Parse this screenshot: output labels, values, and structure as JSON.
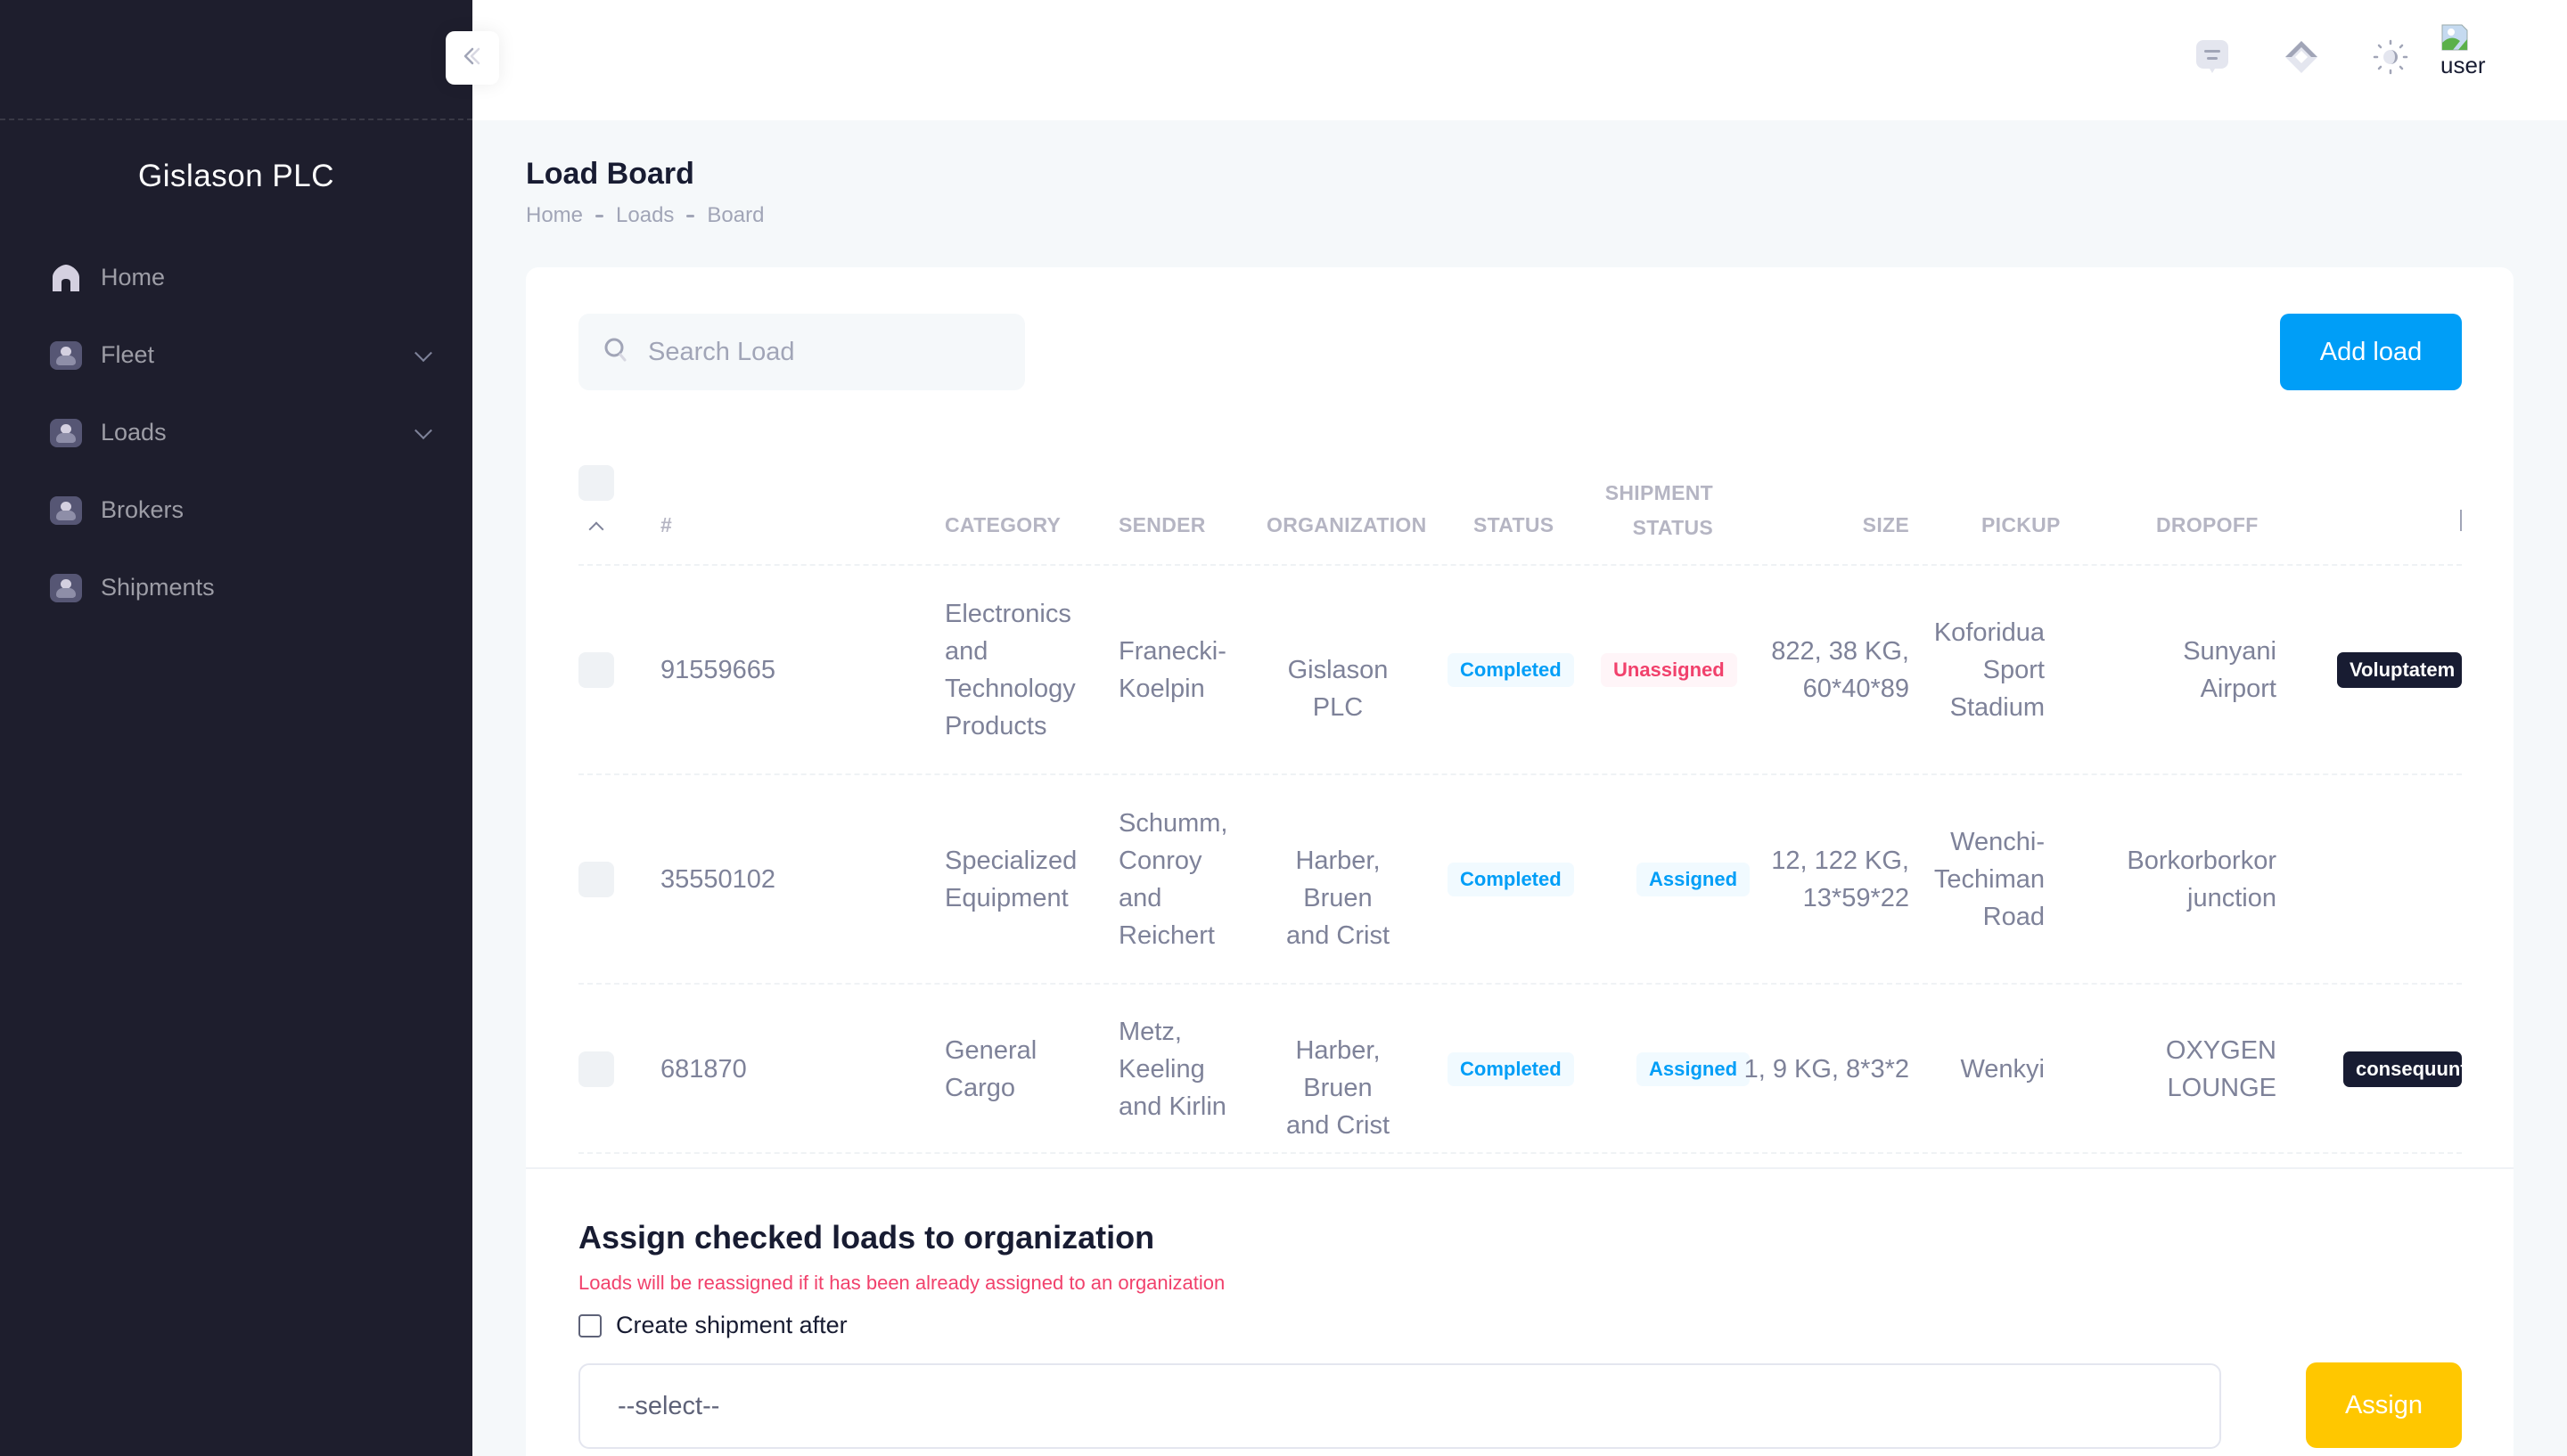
{
  "sidebar": {
    "brand": "Gislason PLC",
    "toggle_icon": "double-chevron-left-icon",
    "items": [
      {
        "label": "Home",
        "icon": "home-icon",
        "expandable": false
      },
      {
        "label": "Fleet",
        "icon": "user-icon",
        "expandable": true
      },
      {
        "label": "Loads",
        "icon": "user-icon",
        "expandable": true
      },
      {
        "label": "Brokers",
        "icon": "user-icon",
        "expandable": false
      },
      {
        "label": "Shipments",
        "icon": "user-icon",
        "expandable": false
      }
    ]
  },
  "header": {
    "icons": [
      "chat-icon",
      "layers-icon",
      "theme-toggle-icon"
    ],
    "user_alt": "user"
  },
  "page": {
    "title": "Load Board",
    "breadcrumb": [
      "Home",
      "Loads",
      "Board"
    ]
  },
  "toolbar": {
    "search_placeholder": "Search Load",
    "add_label": "Add load"
  },
  "table": {
    "columns": {
      "id": "#",
      "category": "CATEGORY",
      "sender": "SENDER",
      "organization": "ORGANIZATION",
      "status": "STATUS",
      "shipment_status_1": "SHIPMENT",
      "shipment_status_2": "STATUS",
      "size": "SIZE",
      "pickup": "PICKUP",
      "dropoff": "DROPOFF"
    },
    "rows": [
      {
        "id": "91559665",
        "category": [
          "Electronics",
          "and",
          "Technology",
          "Products"
        ],
        "sender": [
          "Franecki-",
          "Koelpin"
        ],
        "organization": [
          "Gislason PLC"
        ],
        "status": "Completed",
        "shipment_status": "Unassigned",
        "size": [
          "822, 38 KG,",
          "60*40*89"
        ],
        "pickup": [
          "Koforidua",
          "Sport",
          "Stadium"
        ],
        "dropoff": [
          "Sunyani",
          "Airport"
        ],
        "tag": "Voluptatem"
      },
      {
        "id": "35550102",
        "category": [
          "Specialized",
          "Equipment"
        ],
        "sender": [
          "Schumm,",
          "Conroy",
          "and",
          "Reichert"
        ],
        "organization": [
          "Harber, Bruen",
          "and Crist"
        ],
        "status": "Completed",
        "shipment_status": "Assigned",
        "size": [
          "12, 122 KG,",
          "13*59*22"
        ],
        "pickup": [
          "Wenchi-",
          "Techiman",
          "Road"
        ],
        "dropoff": [
          "Borkorborkor",
          "junction"
        ],
        "tag": ""
      },
      {
        "id": "681870",
        "category": [
          "General",
          "Cargo"
        ],
        "sender": [
          "Metz,",
          "Keeling",
          "and Kirlin"
        ],
        "organization": [
          "Harber, Bruen",
          "and Crist"
        ],
        "status": "Completed",
        "shipment_status": "Assigned",
        "size": [
          "1, 9 KG, 8*3*2"
        ],
        "pickup": [
          "Wenkyi"
        ],
        "dropoff": [
          "OXYGEN",
          "LOUNGE"
        ],
        "tag": "consequuntur"
      }
    ]
  },
  "assign": {
    "title": "Assign checked loads to organization",
    "warning": "Loads will be reassigned if it has been already assigned to an organization",
    "checkbox_label": "Create shipment after",
    "checkbox_checked": false,
    "select_value": "--select--",
    "button_label": "Assign"
  },
  "colors": {
    "sidebar_bg": "#1e1e2d",
    "primary": "#009ef7",
    "warning": "#ffc700",
    "danger": "#f1416c",
    "dark": "#181c32"
  }
}
